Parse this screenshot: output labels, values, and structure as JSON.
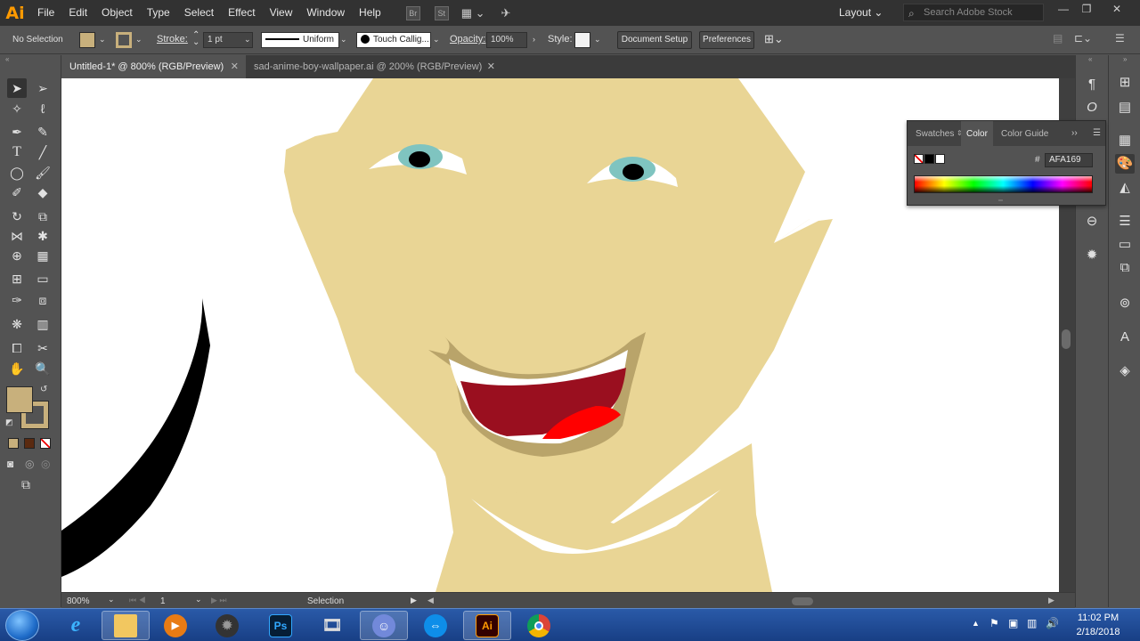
{
  "app": {
    "logo": "Ai"
  },
  "menu": [
    "File",
    "Edit",
    "Object",
    "Type",
    "Select",
    "Effect",
    "View",
    "Window",
    "Help"
  ],
  "menubar_right": {
    "workspace": "Layout ⌄",
    "search_placeholder": "Search Adobe Stock"
  },
  "control": {
    "selection": "No Selection",
    "stroke_label": "Stroke:",
    "stroke_value": "1 pt",
    "profile": "Uniform",
    "brush": "Touch Callig...",
    "opacity_label": "Opacity:",
    "opacity_value": "100%",
    "style_label": "Style:",
    "doc_setup": "Document Setup",
    "preferences": "Preferences",
    "fill_color": "#c8b07c",
    "stroke_color": "#c8b07c"
  },
  "tabs": [
    {
      "label": "Untitled-1* @ 800% (RGB/Preview)",
      "active": true
    },
    {
      "label": "sad-anime-boy-wallpaper.ai @ 200% (RGB/Preview)",
      "active": false
    }
  ],
  "status": {
    "zoom": "800%",
    "artboard": "1",
    "tool": "Selection"
  },
  "color_panel": {
    "tabs": [
      "Swatches",
      "Color",
      "Color Guide"
    ],
    "hex_label": "#",
    "hex_value": "AFA169"
  },
  "artwork": {
    "skin": "#e9d595",
    "outline": "#b9a46a",
    "eye_iris": "#7fc4c0",
    "mouth": "#9a0f1f",
    "tongue": "#ff0000",
    "hair": "#000000"
  },
  "taskbar": {
    "apps": [
      "start",
      "internet-explorer",
      "file-explorer",
      "media-player",
      "grenade-app",
      "photoshop",
      "video-editor",
      "discord",
      "teamviewer",
      "illustrator",
      "chrome"
    ],
    "ps_label": "Ps",
    "ai_label": "Ai",
    "time": "11:02 PM",
    "date": "2/18/2018"
  }
}
